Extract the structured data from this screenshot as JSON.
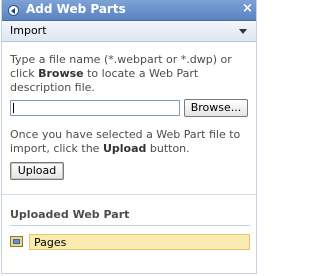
{
  "panel": {
    "title": "Add Web Parts",
    "close_glyph": "×"
  },
  "dropdown": {
    "selected": "Import"
  },
  "import": {
    "description_part1": "Type a file name (*.webpart or *.dwp) or click ",
    "description_bold": "Browse",
    "description_part2": " to locate a Web Part description file.",
    "file_value": "",
    "browse_label": "Browse...",
    "instruction_part1": "Once you have selected a Web Part file to import, click the ",
    "instruction_bold": "Upload",
    "instruction_part2": " button.",
    "upload_label": "Upload"
  },
  "uploaded": {
    "heading": "Uploaded Web Part",
    "items": [
      {
        "label": "Pages",
        "icon": "webpart-icon"
      }
    ]
  },
  "colors": {
    "titlebar": "#6a91cc",
    "selected_row": "#fbeab0"
  }
}
